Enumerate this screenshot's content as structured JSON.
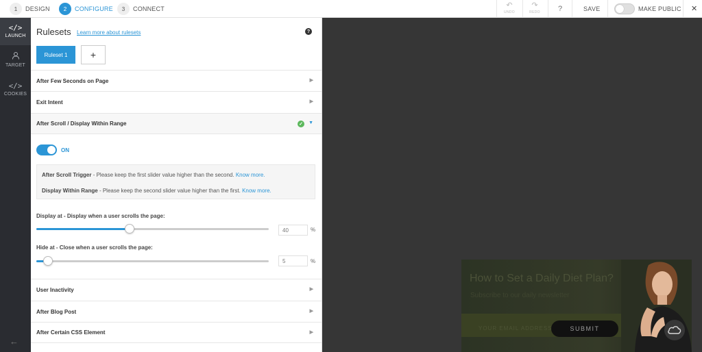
{
  "steps": [
    {
      "num": "1",
      "label": "DESIGN"
    },
    {
      "num": "2",
      "label": "CONFIGURE"
    },
    {
      "num": "3",
      "label": "CONNECT"
    }
  ],
  "toolbar": {
    "undo_label": "UNDO",
    "redo_label": "REDO",
    "help_glyph": "?",
    "save_label": "SAVE",
    "make_public_label": "MAKE PUBLIC",
    "close_glyph": "✕"
  },
  "leftnav": [
    {
      "glyph": "</>",
      "label": "LAUNCH",
      "icon": "code-icon"
    },
    {
      "glyph": "👤",
      "label": "TARGET",
      "icon": "user-icon"
    },
    {
      "glyph": "</>",
      "label": "COOKIES",
      "icon": "code-icon"
    }
  ],
  "panel": {
    "title": "Rulesets",
    "learn_link": "Learn more about rulesets",
    "help_glyph": "?",
    "tab_label": "Ruleset 1",
    "add_glyph": "+",
    "rules_top": [
      "After Few Seconds on Page",
      "Exit Intent",
      "After Scroll / Display Within Range"
    ],
    "toggle_label": "ON",
    "info": {
      "line1_bold": "After Scroll Trigger",
      "line1_text": " - Please keep the first slider value higher than the second. ",
      "line1_link": "Know more.",
      "line2_bold": "Display Within Range",
      "line2_text": " - Please keep the second slider value higher than the first. ",
      "line2_link": "Know more."
    },
    "slider1": {
      "label": "Display at - Display when a user scrolls the page:",
      "value": "40",
      "unit": "%",
      "percent": 40
    },
    "slider2": {
      "label": "Hide at - Close when a user scrolls the page:",
      "value": "5",
      "unit": "%",
      "percent": 5
    },
    "rules_bottom": [
      "User Inactivity",
      "After Blog Post",
      "After Certain CSS Element"
    ]
  },
  "preview": {
    "title": "How to Set a Daily Diet Plan?",
    "subtitle": "Subscribe to our daily newsletter",
    "email_placeholder": "YOUR EMAIL ADDRESS",
    "submit_label": "SUBMIT"
  },
  "colors": {
    "accent": "#2b95d6",
    "nav_bg": "#2a2c31",
    "preview_bg": "#363636",
    "check": "#5cb85c"
  }
}
